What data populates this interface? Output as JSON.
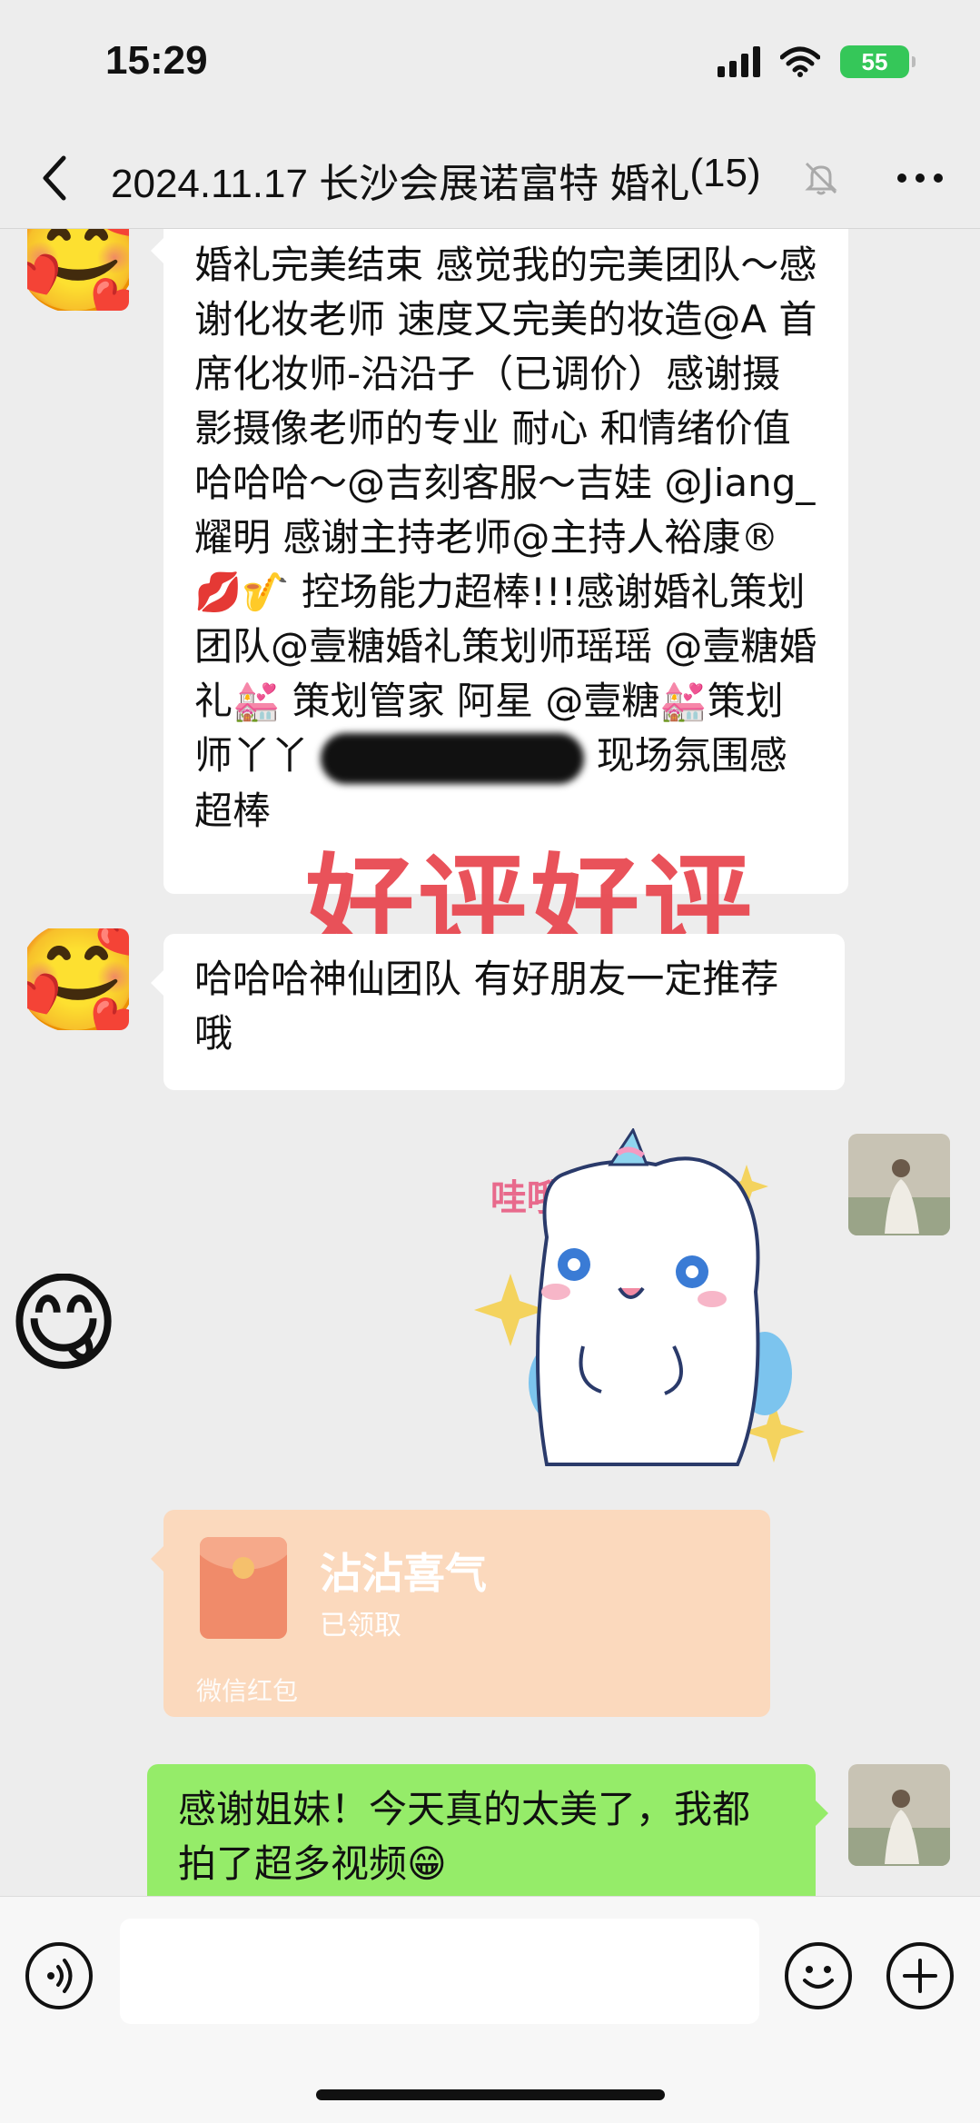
{
  "status_bar": {
    "time": "15:29",
    "battery": "55"
  },
  "nav": {
    "title": "2024.11.17 长沙会展诺富特 婚礼",
    "count": "(15)"
  },
  "messages": [
    {
      "id": "msg1",
      "side": "left",
      "avatar": "smiling-face-with-hearts",
      "avatar_glyph": "🥰",
      "text_part1": "婚礼完美结束 感觉我的完美团队～感谢化妆老师 速度又完美的妆造@A 首席化妆师-沿沿子（已调价）感谢摄影摄像老师的专业 耐心 和情绪价值哈哈哈～@吉刻客服～吉娃 @Jiang_耀明 感谢主持老师@主持人裕康®💋🎷 控场能力超棒!!!感谢婚礼策划团队@壹糖婚礼策划师瑶瑶 @壹糖婚礼💒 策划管家  阿星 @壹糖💒策划师丫丫 ",
      "text_part2": " 现场氛围感超棒",
      "overlay": "好评好评"
    },
    {
      "id": "msg2",
      "side": "left",
      "avatar": "smiling-face-with-hearts",
      "avatar_glyph": "🥰",
      "text": "哈哈哈神仙团队 有好朋友一定推荐哦"
    },
    {
      "id": "msg3",
      "side": "right",
      "type": "sticker",
      "sticker_text": "哇哦"
    },
    {
      "id": "msg4",
      "side": "left",
      "avatar": "face-savoring-food",
      "avatar_glyph": "😋",
      "type": "red-packet",
      "title": "沾沾喜气",
      "status": "已领取",
      "footer": "微信红包"
    },
    {
      "id": "msg5",
      "side": "right",
      "text": "感谢姐妹！今天真的太美了，我都拍了超多视频😁"
    }
  ],
  "colors": {
    "background": "#ededed",
    "green_bubble": "#95ec69",
    "red_packet": "#fbd9bd",
    "overlay_red": "#e8444d",
    "battery": "#35c759"
  }
}
